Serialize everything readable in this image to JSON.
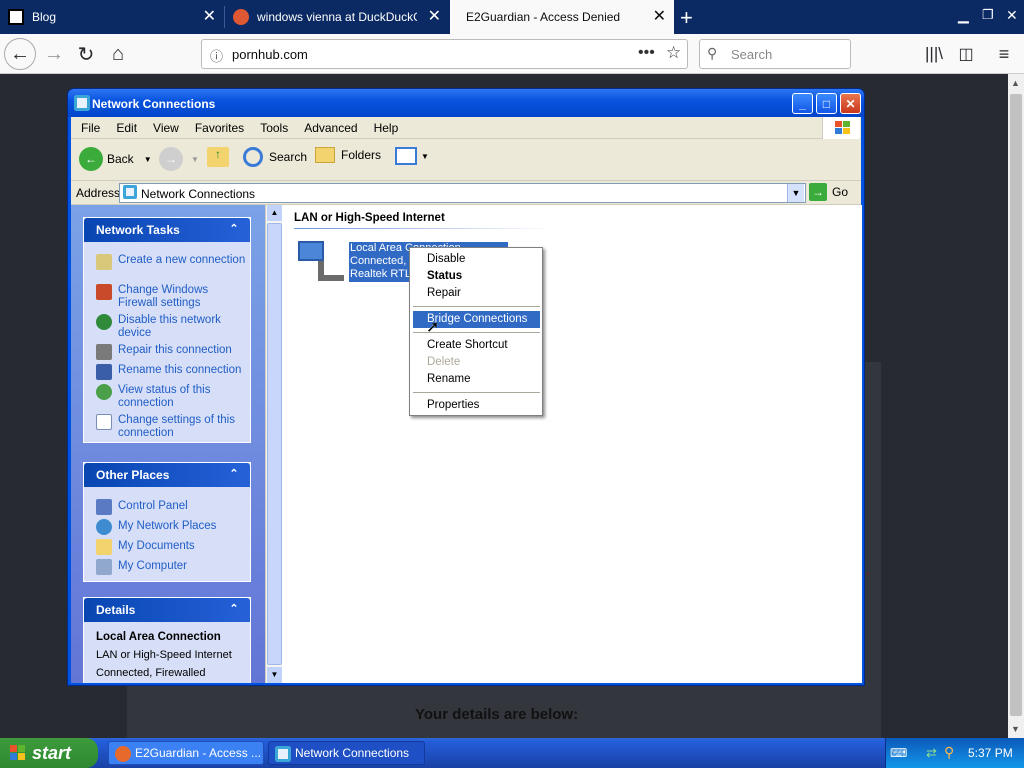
{
  "browser": {
    "tabs": [
      {
        "title": "Blog",
        "active": false
      },
      {
        "title": "windows vienna at DuckDuckGo",
        "active": false
      },
      {
        "title": "E2Guardian - Access Denied",
        "active": true
      }
    ],
    "url": "pornhub.com",
    "search_placeholder": "Search",
    "page_text": "Your details are below:"
  },
  "window": {
    "title": "Network Connections",
    "menu": [
      "File",
      "Edit",
      "View",
      "Favorites",
      "Tools",
      "Advanced",
      "Help"
    ],
    "toolbar": {
      "back": "Back",
      "search": "Search",
      "folders": "Folders"
    },
    "address_label": "Address",
    "address_value": "Network Connections",
    "go": "Go"
  },
  "network_tasks": {
    "title": "Network Tasks",
    "items": [
      "Create a new connection",
      "Change Windows Firewall settings",
      "Disable this network device",
      "Repair this connection",
      "Rename this connection",
      "View status of this connection",
      "Change settings of this connection"
    ]
  },
  "other_places": {
    "title": "Other Places",
    "items": [
      "Control Panel",
      "My Network Places",
      "My Documents",
      "My Computer"
    ]
  },
  "details": {
    "title": "Details",
    "name": "Local Area Connection",
    "type": "LAN or High-Speed Internet",
    "status": "Connected, Firewalled"
  },
  "content": {
    "group_header": "LAN or High-Speed Internet",
    "connection": {
      "line1": "Local Area Connection",
      "line2": "Connected,",
      "line3": "Realtek RTL"
    }
  },
  "context_menu": {
    "items": [
      {
        "label": "Disable",
        "bold": false,
        "disabled": false
      },
      {
        "label": "Status",
        "bold": true,
        "disabled": false
      },
      {
        "label": "Repair",
        "bold": false,
        "disabled": false
      },
      {
        "label": "Bridge Connections",
        "bold": false,
        "disabled": false,
        "highlighted": true
      },
      {
        "label": "Create Shortcut",
        "bold": false,
        "disabled": false
      },
      {
        "label": "Delete",
        "bold": false,
        "disabled": true
      },
      {
        "label": "Rename",
        "bold": false,
        "disabled": false
      },
      {
        "label": "Properties",
        "bold": false,
        "disabled": false
      }
    ]
  },
  "taskbar": {
    "start": "start",
    "buttons": [
      "E2Guardian - Access ...",
      "Network Connections"
    ],
    "clock": "5:37 PM"
  },
  "colors": {
    "xp_blue": "#0053e1",
    "task_link": "#215dc6",
    "selection": "#316ac5"
  }
}
